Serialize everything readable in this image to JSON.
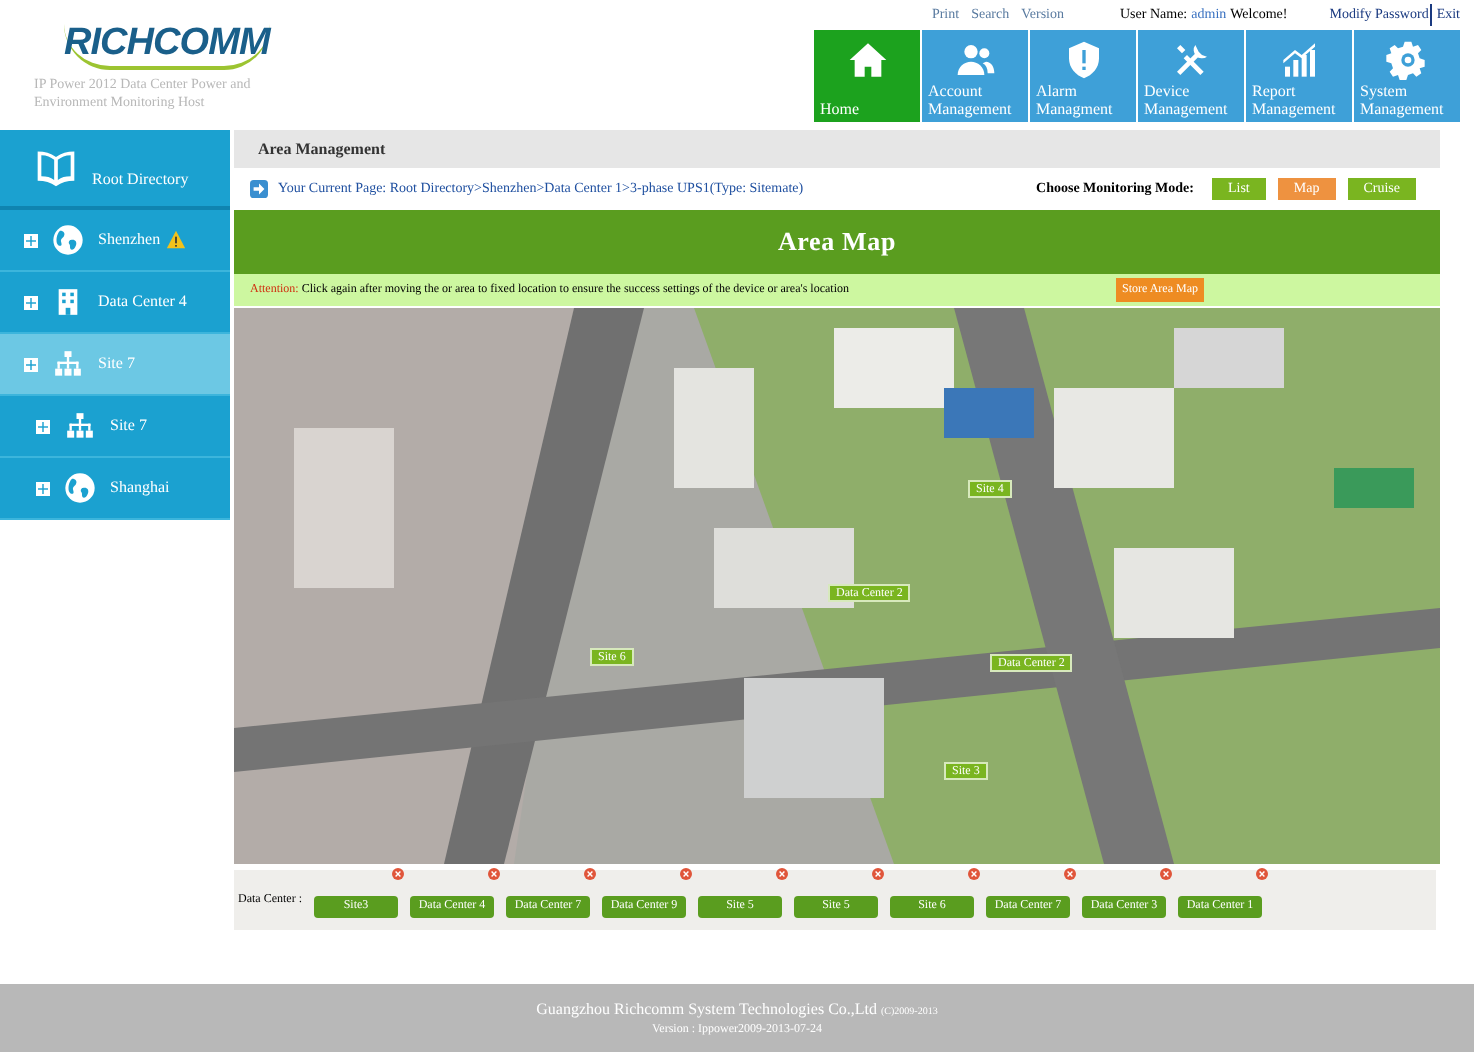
{
  "header": {
    "logo": "RICHCOMM",
    "subtitle": "IP Power 2012 Data Center Power and Environment Monitoring Host",
    "top_links": [
      "Print",
      "Search",
      "Version"
    ],
    "user_label": "User Name:",
    "user_name": "admin",
    "welcome": "Welcome!",
    "account_links": [
      "Modify Password",
      "Exit"
    ]
  },
  "nav": [
    {
      "label": "Home",
      "kind": "home",
      "selected": true
    },
    {
      "label": "Account Management",
      "kind": "users",
      "selected": false
    },
    {
      "label": "Alarm Managment",
      "kind": "shield",
      "selected": false
    },
    {
      "label": "Device Management",
      "kind": "tools",
      "selected": false
    },
    {
      "label": "Report Management",
      "kind": "chart",
      "selected": false
    },
    {
      "label": "System Management",
      "kind": "gear",
      "selected": false
    }
  ],
  "sidebar": {
    "root": "Root Directory",
    "items": [
      {
        "label": "Shenzhen",
        "kind": "globe",
        "warning": true,
        "selected": false
      },
      {
        "label": "Data Center 4",
        "kind": "building",
        "warning": false,
        "selected": false
      },
      {
        "label": "Site 7",
        "kind": "network",
        "warning": false,
        "selected": true,
        "children": [
          {
            "label": "Site 7",
            "kind": "network",
            "warning": false,
            "selected": false
          },
          {
            "label": "Shanghai",
            "kind": "globe",
            "warning": false,
            "selected": false
          }
        ]
      }
    ]
  },
  "section_title": "Area Management",
  "breadcrumb": "Your Current Page: Root Directory>Shenzhen>Data Center 1>3-phase UPS1(Type: Sitemate)",
  "monitoring_mode": {
    "label": "Choose Monitoring Mode:",
    "options": [
      {
        "label": "List",
        "selected": false
      },
      {
        "label": "Map",
        "selected": true
      },
      {
        "label": "Cruise",
        "selected": false
      }
    ]
  },
  "area_map": {
    "title": "Area Map",
    "attention_label": "Attention:",
    "attention_text": "Click again after moving the or area to fixed location to ensure the success settings of the device or area's location",
    "store_button": "Store Area Map",
    "markers": [
      "Site 4",
      "Data Center 2",
      "Site 6",
      "Data Center 2",
      "Site 3"
    ]
  },
  "data_center": {
    "label": "Data Center :",
    "tags": [
      "Site3",
      "Data Center 4",
      "Data Center 7",
      "Data Center 9",
      "Site 5",
      "Site 5",
      "Site 6",
      "Data Center 7",
      "Data Center 3",
      "Data Center 1"
    ]
  },
  "footer": {
    "company": "Guangzhou Richcomm System Technologies Co.,Ltd",
    "copyright": "(C)2009-2013",
    "version": "Version : Ippower2009-2013-07-24"
  }
}
